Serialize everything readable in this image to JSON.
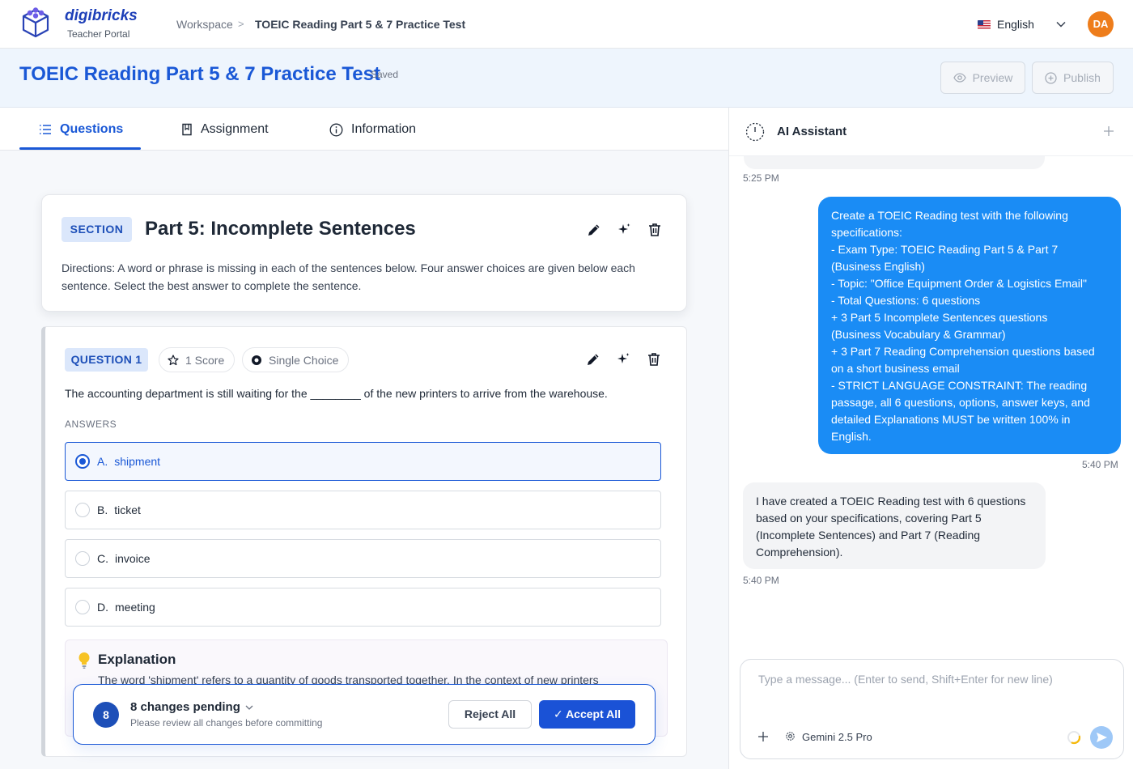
{
  "header": {
    "brand": "digibricks",
    "brand_sub": "Teacher Portal",
    "breadcrumb": {
      "root": "Workspace",
      "sep": ">",
      "current": "TOEIC Reading Part 5 & 7 Practice Test"
    },
    "language": "English",
    "avatar_initials": "DA"
  },
  "titlebar": {
    "title": "TOEIC Reading Part 5 & 7 Practice Test",
    "status": "Saved",
    "preview_label": "Preview",
    "publish_label": "Publish"
  },
  "tabs": [
    {
      "label": "Questions",
      "icon": "list-icon",
      "active": true
    },
    {
      "label": "Assignment",
      "icon": "book-icon",
      "active": false
    },
    {
      "label": "Information",
      "icon": "info-icon",
      "active": false
    }
  ],
  "section": {
    "chip": "SECTION",
    "title": "Part 5: Incomplete Sentences",
    "directions": "Directions: A word or phrase is missing in each of the sentences below. Four answer choices are given below each sentence. Select the best answer to complete the sentence."
  },
  "question": {
    "chip": "QUESTION 1",
    "score": "1 Score",
    "type": "Single Choice",
    "text": "The accounting department is still waiting for the ________ of the new printers to arrive from the warehouse.",
    "answers_label": "ANSWERS",
    "answers": [
      {
        "letter": "A.",
        "text": "shipment",
        "selected": true
      },
      {
        "letter": "B.",
        "text": "ticket",
        "selected": false
      },
      {
        "letter": "C.",
        "text": "invoice",
        "selected": false
      },
      {
        "letter": "D.",
        "text": "meeting",
        "selected": false
      }
    ],
    "explanation_title": "Explanation",
    "explanation_text": "The word 'shipment' refers to a quantity of goods transported together. In the context of new printers"
  },
  "pending": {
    "count": "8",
    "title": "8 changes pending",
    "subtitle": "Please review all changes before committing",
    "reject_label": "Reject All",
    "accept_label": "✓ Accept All"
  },
  "assistant": {
    "title": "AI Assistant",
    "messages": [
      {
        "role": "assistant",
        "time": "5:25 PM"
      },
      {
        "role": "user",
        "lines": [
          "Create a TOEIC Reading test with the following",
          "specifications:",
          "- Exam Type: TOEIC Reading Part 5 & Part 7",
          "(Business English)",
          "- Topic: \"Office Equipment Order & Logistics Email\"",
          "- Total Questions: 6 questions",
          "+ 3 Part 5 Incomplete Sentences questions",
          "(Business Vocabulary & Grammar)",
          "+ 3 Part 7 Reading Comprehension questions based",
          "on a short business email",
          "- STRICT LANGUAGE CONSTRAINT: The reading",
          "passage, all 6 questions, options, answer keys, and",
          "detailed Explanations MUST be written 100% in",
          "English."
        ],
        "time": "5:40 PM"
      },
      {
        "role": "assistant",
        "lines": [
          "I have created a TOEIC Reading test with 6 questions",
          "based on your specifications, covering Part 5",
          "(Incomplete Sentences) and Part 7 (Reading",
          "Comprehension)."
        ],
        "time": "5:40 PM"
      }
    ],
    "composer_placeholder": "Type a message... (Enter to send, Shift+Enter for new line)",
    "model": "Gemini 2.5 Pro"
  },
  "colors": {
    "accent": "#1a58d6",
    "user_bubble": "#1a8cf5",
    "avatar": "#ee7d1b",
    "title_band": "#eef5fd"
  }
}
